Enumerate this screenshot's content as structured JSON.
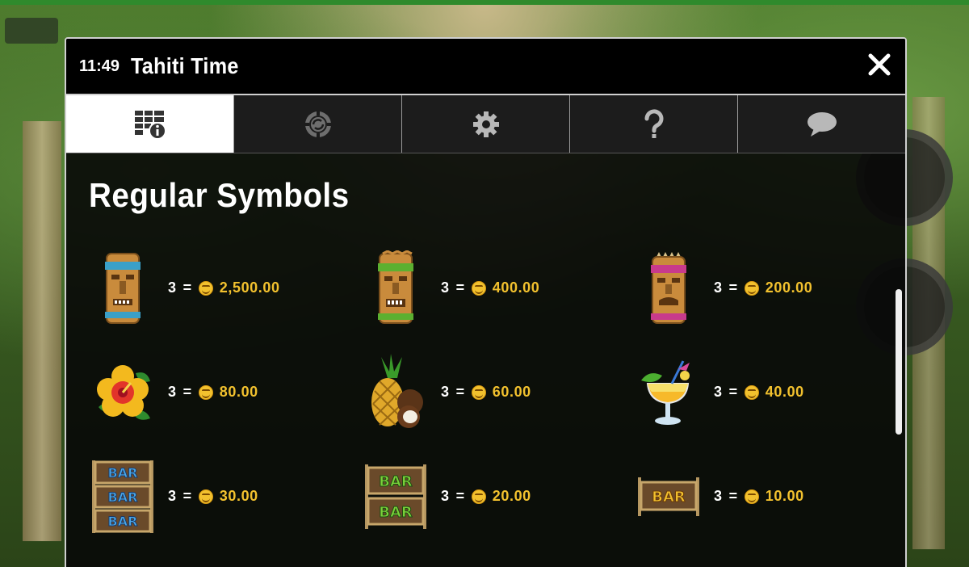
{
  "header": {
    "clock": "11:49",
    "title": "Tahiti Time"
  },
  "tabs": [
    {
      "id": "paytable",
      "icon": "paytable-info-icon",
      "active": true
    },
    {
      "id": "autoplay",
      "icon": "chip-icon",
      "active": false
    },
    {
      "id": "settings",
      "icon": "gear-icon",
      "active": false
    },
    {
      "id": "help",
      "icon": "question-mark-icon",
      "active": false
    },
    {
      "id": "chat",
      "icon": "speech-bubble-icon",
      "active": false
    }
  ],
  "section": {
    "title": "Regular Symbols"
  },
  "symbols": [
    {
      "icon": "blue-tiki-mask-icon",
      "count": "3",
      "eq": "=",
      "amount": "2,500.00"
    },
    {
      "icon": "green-tiki-mask-icon",
      "count": "3",
      "eq": "=",
      "amount": "400.00"
    },
    {
      "icon": "pink-tiki-mask-icon",
      "count": "3",
      "eq": "=",
      "amount": "200.00"
    },
    {
      "icon": "hibiscus-flower-icon",
      "count": "3",
      "eq": "=",
      "amount": "80.00"
    },
    {
      "icon": "pineapple-coconut-icon",
      "count": "3",
      "eq": "=",
      "amount": "60.00"
    },
    {
      "icon": "cocktail-icon",
      "count": "3",
      "eq": "=",
      "amount": "40.00"
    },
    {
      "icon": "triple-bar-icon",
      "count": "3",
      "eq": "=",
      "amount": "30.00"
    },
    {
      "icon": "double-bar-icon",
      "count": "3",
      "eq": "=",
      "amount": "20.00"
    },
    {
      "icon": "single-bar-icon",
      "count": "3",
      "eq": "=",
      "amount": "10.00"
    }
  ],
  "colors": {
    "amount": "#f2c12e",
    "tab_active_bg": "#ffffff",
    "tab_bg": "#1c1c1c"
  }
}
